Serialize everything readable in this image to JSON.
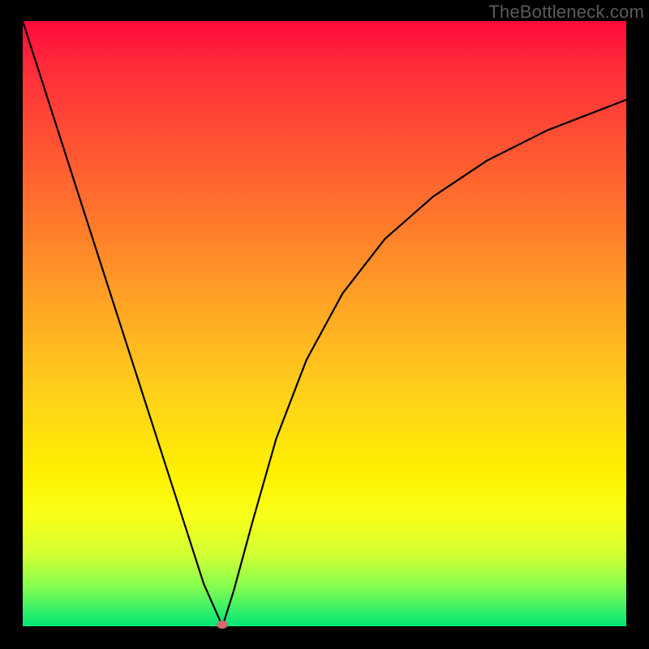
{
  "watermark": "TheBottleneck.com",
  "chart_data": {
    "type": "line",
    "title": "",
    "xlabel": "",
    "ylabel": "",
    "x_range": [
      0,
      1
    ],
    "y_range": [
      0,
      1
    ],
    "series": [
      {
        "name": "curve",
        "x": [
          0.0,
          0.05,
          0.1,
          0.15,
          0.2,
          0.25,
          0.3,
          0.331,
          0.35,
          0.38,
          0.42,
          0.47,
          0.53,
          0.6,
          0.68,
          0.77,
          0.87,
          1.0
        ],
        "y": [
          1.0,
          0.845,
          0.69,
          0.535,
          0.38,
          0.225,
          0.07,
          0.0,
          0.06,
          0.17,
          0.31,
          0.44,
          0.55,
          0.64,
          0.71,
          0.77,
          0.82,
          0.87
        ]
      }
    ],
    "marker": {
      "x": 0.331,
      "y": 0.0,
      "color": "#d26a6f"
    },
    "background_gradient": {
      "orientation": "vertical",
      "stops": [
        {
          "pos": 0.0,
          "color": "#ff0a3c"
        },
        {
          "pos": 0.35,
          "color": "#ff7f2a"
        },
        {
          "pos": 0.62,
          "color": "#ffd21a"
        },
        {
          "pos": 0.82,
          "color": "#f8ff1a"
        },
        {
          "pos": 1.0,
          "color": "#00e676"
        }
      ]
    },
    "grid": false,
    "legend": false
  }
}
